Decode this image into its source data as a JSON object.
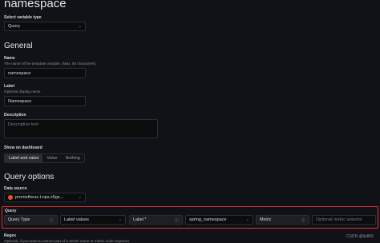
{
  "page": {
    "title": "namespace"
  },
  "variable_type": {
    "label": "Select variable type",
    "value": "Query"
  },
  "general": {
    "heading": "General",
    "name_label": "Name",
    "name_desc": "The name of the template variable. (Max. 50 characters)",
    "name_value": "namespace",
    "label_label": "Label",
    "label_desc": "Optional display name",
    "label_value": "Namespace",
    "description_label": "Description",
    "description_placeholder": "Descriptive text",
    "show_label": "Show on dashboard",
    "show_options": [
      "Label and value",
      "Value",
      "Nothing"
    ],
    "show_selected": "Label and value"
  },
  "query_options": {
    "heading": "Query options",
    "datasource_label": "Data source",
    "datasource_value": "prometheus.t.ops.x6gx...",
    "query_label": "Query",
    "query_type_label": "Query Type",
    "query_type_value": "Label values",
    "label_field_label": "Label *",
    "label_field_value": "spring_namespace",
    "metric_label": "Metric",
    "metric_placeholder": "Optional metric selector",
    "regex_label": "Regex",
    "regex_desc": "Optional, if you want to extract part of a series name or metric node segment."
  },
  "watermark": "CSDN @liu866",
  "colors": {
    "highlight_border": "#e02f2f",
    "background": "#111217",
    "datasource_icon": "#e6522c"
  }
}
